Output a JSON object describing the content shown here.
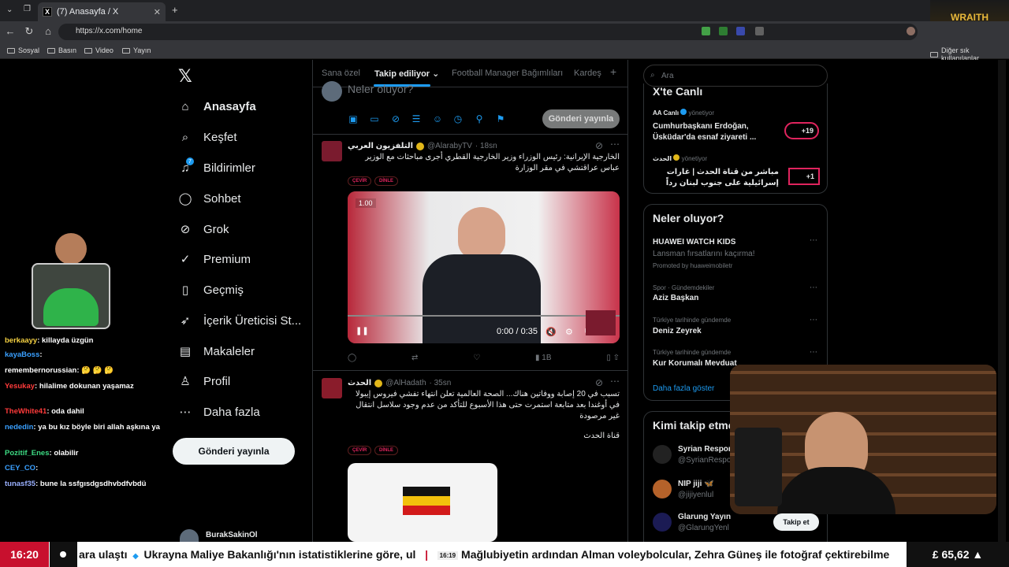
{
  "browser": {
    "tab_title": "(7) Anasayfa / X",
    "url": "https://x.com/home",
    "bookmarks": [
      "Sosyal",
      "Basın",
      "Video",
      "Yayın"
    ],
    "other_bookmarks": "Diğer sık kullanılanlar",
    "stream_logo": "WRAITH"
  },
  "nav": {
    "items": [
      {
        "label": "Anasayfa",
        "icon": "home-icon"
      },
      {
        "label": "Keşfet",
        "icon": "search-icon"
      },
      {
        "label": "Bildirimler",
        "icon": "bell-icon",
        "badge": "7"
      },
      {
        "label": "Sohbet",
        "icon": "chat-icon"
      },
      {
        "label": "Grok",
        "icon": "grok-icon"
      },
      {
        "label": "Premium",
        "icon": "premium-icon"
      },
      {
        "label": "Geçmiş",
        "icon": "bookmark-icon"
      },
      {
        "label": "İçerik Üreticisi St...",
        "icon": "rocket-icon"
      },
      {
        "label": "Makaleler",
        "icon": "article-icon"
      },
      {
        "label": "Profil",
        "icon": "user-icon"
      },
      {
        "label": "Daha fazla",
        "icon": "more-icon"
      }
    ],
    "post_button": "Gönderi yayınla",
    "account_name": "BurakSakinOl"
  },
  "feed": {
    "tabs": [
      "Sana özel",
      "Takip ediliyor",
      "Football Manager Bağımlıları",
      "Kardeş"
    ],
    "composer_placeholder": "Neler oluyor?",
    "send_button": "Gönderi yayınla",
    "posts": [
      {
        "name": "التلفزيون العربي",
        "handle": "@AlarabyTV",
        "time": "· 18sn",
        "text": "الخارجية الإيرانية: رئيس الوزراء وزير الخارجية القطري أجرى مباحثات مع الوزير عباس عراقتشي في مقر الوزارة",
        "chips": [
          "ÇEVİR",
          "DİNLE"
        ],
        "video_time": "0:00 / 0:35",
        "speed": "1.00",
        "views": "1B"
      },
      {
        "name": "الحدث",
        "handle": "@AlHadath",
        "time": "· 35sn",
        "text": "تسبب في 20 إصابة ووفاتين هناك... الصحة العالمية تعلن انتهاء تفشي فيروس إيبولا في أوغندا بعد متابعة استمرت حتى هذا الأسبوع للتأكد من عدم وجود سلاسل انتقال غير مرصودة",
        "text2": "قناة الحدث",
        "chips": [
          "ÇEVİR",
          "DİNLE"
        ]
      }
    ]
  },
  "sidebar": {
    "search_placeholder": "Ara",
    "live_title": "X'te Canlı",
    "live": [
      {
        "host": "AA Canlı",
        "role": "yönetiyor",
        "title": "Cumhurbaşkanı Erdoğan, Üsküdar'da esnaf ziyareti ...",
        "count": "+19"
      },
      {
        "host": "الحدث",
        "role": "yönetiyor",
        "title": "مباشر من قناة الحدث | غارات إسرائيلية على جنوب لبنان رداً على \"مسيرات حزب",
        "count": "+1"
      }
    ],
    "trends_title": "Neler oluyor?",
    "trends": [
      {
        "meta": "",
        "title": "HUAWEI WATCH KIDS",
        "sub": "Lansman fırsatlarını kaçırma!",
        "promo": "Promoted by huaweimobiletr"
      },
      {
        "meta": "Spor · Gündemdekiler",
        "title": "Aziz Başkan"
      },
      {
        "meta": "Türkiye tarihinde gündemde",
        "title": "Deniz Zeyrek"
      },
      {
        "meta": "Türkiye tarihinde gündemde",
        "title": "Kur Korumalı Mevduat"
      }
    ],
    "show_more": "Daha fazla göster",
    "who_to_follow": "Kimi takip etme",
    "follow": [
      {
        "name": "Syrian Respon",
        "handle": "@SyrianRespon"
      },
      {
        "name": "NIP jiji 🦋",
        "handle": "@jijiyenlul"
      },
      {
        "name": "Glarung Yayın",
        "handle": "@GlarungYenl"
      }
    ],
    "follow_button": "Takip et"
  },
  "chat": [
    {
      "user": "berkaayy",
      "msg": "killayda üzgün",
      "color": "#f5d142"
    },
    {
      "user": "kayaBoss",
      "msg": "",
      "color": "#3aa0ff"
    },
    {
      "user": "remembernorussian",
      "msg": "🤔 🤔 🤔",
      "color": "#ffffff"
    },
    {
      "user": "Yesukay",
      "msg": "hilalime dokunan yaşamaz",
      "color": "#ff3b3b"
    },
    {
      "user": "TheWhite41",
      "msg": "oda dahil",
      "color": "#ff3b3b"
    },
    {
      "user": "nededin",
      "msg": "ya bu kız böyle biri allah aşkına ya",
      "color": "#3aa0ff"
    },
    {
      "user": "Pozitif_Enes",
      "msg": "olabilir",
      "color": "#3ddc84"
    },
    {
      "user": "CEY_CO",
      "msg": "",
      "color": "#3aa0ff"
    },
    {
      "user": "tunasf35",
      "msg": "bune la ssfgısdgsdhvbdfvbdü",
      "color": "#9ab0ff"
    }
  ],
  "ticker": {
    "clock": "16:20",
    "items": [
      "ara ulaştı",
      "Ukrayna Maliye Bakanlığı'nın istatistiklerine göre, ul",
      "Mağlubiyetin ardından Alman voleybolcular, Zehra Güneş ile fotoğraf çektirebilme"
    ],
    "stamp": "16:19",
    "price": "£ 65,62 ▲"
  }
}
